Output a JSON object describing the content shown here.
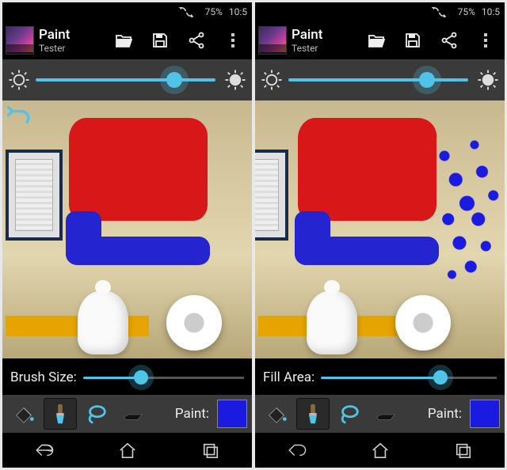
{
  "statusbar": {
    "battery_pct": "75%",
    "time": "10:5"
  },
  "app": {
    "title": "Paint",
    "subtitle": "Tester"
  },
  "brightness": {
    "value_pct": 77
  },
  "panes": [
    {
      "slider_label": "Brush Size:",
      "slider_value_pct": 36,
      "paint_label": "Paint:",
      "swatch_color": "#1a1ae0",
      "has_undo_icon": true,
      "has_blue_splat": false,
      "active_tool": "brush"
    },
    {
      "slider_label": "Fill Area:",
      "slider_value_pct": 68,
      "paint_label": "Paint:",
      "swatch_color": "#1a1ae0",
      "has_undo_icon": false,
      "has_blue_splat": true,
      "active_tool": "brush"
    }
  ],
  "tools": [
    "bucket",
    "brush",
    "lasso",
    "eraser"
  ],
  "colors": {
    "accent": "#4fc4e8",
    "red": "#d81818",
    "blue": "#2424d0"
  }
}
